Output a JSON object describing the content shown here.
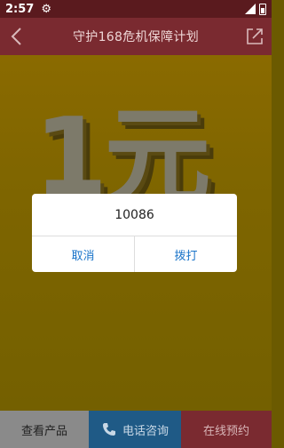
{
  "status_bar": {
    "time": "2:57",
    "network": "LTE"
  },
  "nav": {
    "title": "守护168危机保障计划"
  },
  "banner": {
    "text": "1元"
  },
  "dialog": {
    "message": "10086",
    "cancel_label": "取消",
    "call_label": "拨打"
  },
  "tabs": {
    "products_label": "查看产品",
    "phone_label": "电话咨询",
    "online_label": "在线预约"
  }
}
